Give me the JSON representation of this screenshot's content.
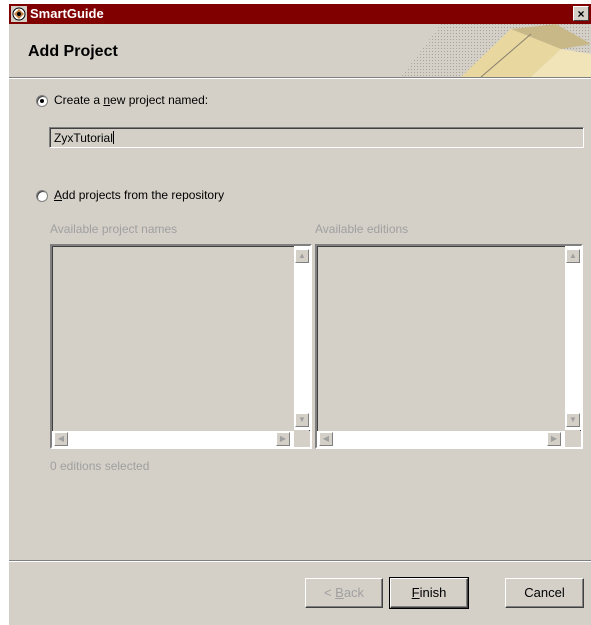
{
  "window": {
    "title": "SmartGuide",
    "close_glyph": "×"
  },
  "header": {
    "heading": "Add Project"
  },
  "create_option": {
    "label_before": "Create a ",
    "label_mnemonic": "n",
    "label_after": "ew project named:",
    "selected": true,
    "project_name_value": "ZyxTutorial"
  },
  "repo_option": {
    "label_mnemonic": "A",
    "label_after": "dd projects from the repository",
    "selected": false
  },
  "lists": {
    "project_names_label": "Available project names",
    "editions_label": "Available editions",
    "selection_status": "0 editions selected"
  },
  "buttons": {
    "back": {
      "mnemonic": "B",
      "label_before": "< ",
      "label_after": "ack",
      "enabled": false
    },
    "finish": {
      "mnemonic": "F",
      "label_after": "inish",
      "enabled": true
    },
    "cancel": {
      "label": "Cancel",
      "enabled": true
    }
  },
  "icons": {
    "app": "smartguide-app-icon",
    "scroll_up": "▲",
    "scroll_down": "▼",
    "scroll_left": "◀",
    "scroll_right": "▶"
  },
  "colors": {
    "titlebar": "#800000",
    "face": "#d4d0c8",
    "disabled_text": "#a0a0a0"
  }
}
